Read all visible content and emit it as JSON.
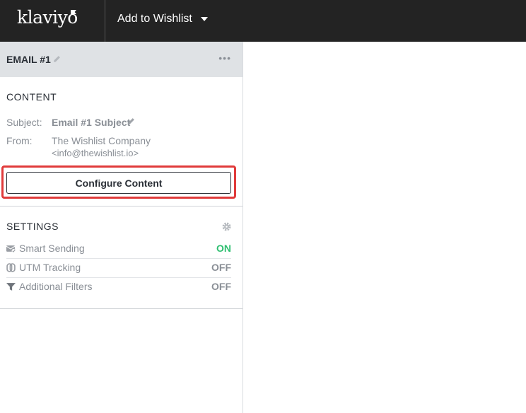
{
  "header": {
    "logo": "klaviyo",
    "flow_name": "Add to Wishlist"
  },
  "panel": {
    "title": "EMAIL #1",
    "content": {
      "heading": "CONTENT",
      "subject_label": "Subject:",
      "subject_value": "Email #1 Subject",
      "from_label": "From:",
      "from_name": "The Wishlist Company",
      "from_email": "<info@thewishlist.io>",
      "configure_button": "Configure Content"
    },
    "settings": {
      "heading": "SETTINGS",
      "items": [
        {
          "label": "Smart Sending",
          "status": "ON",
          "icon": "envelope-check-icon"
        },
        {
          "label": "UTM Tracking",
          "status": "OFF",
          "icon": "link-icon"
        },
        {
          "label": "Additional Filters",
          "status": "OFF",
          "icon": "filter-icon"
        }
      ]
    }
  },
  "colors": {
    "on": "#2fbf71",
    "off": "#8a8f96",
    "highlight": "#e03a3a"
  }
}
